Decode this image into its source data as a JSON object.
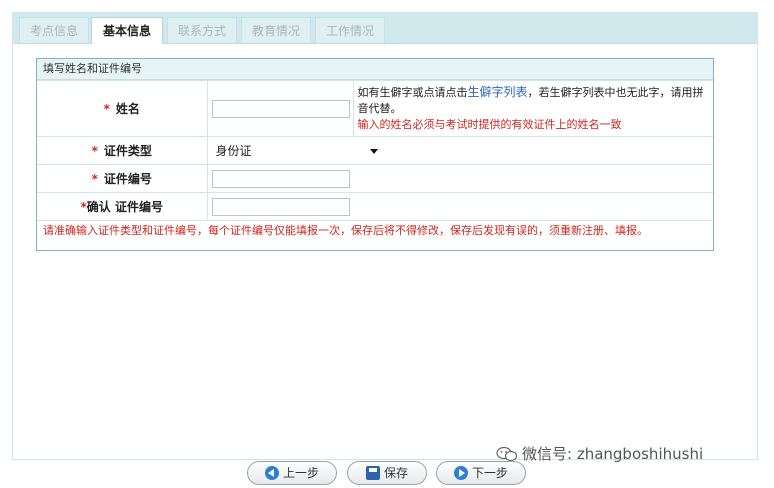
{
  "tabs": [
    {
      "label": "考点信息",
      "active": false
    },
    {
      "label": "基本信息",
      "active": true
    },
    {
      "label": "联系方式",
      "active": false
    },
    {
      "label": "教育情况",
      "active": false
    },
    {
      "label": "工作情况",
      "active": false
    }
  ],
  "section": {
    "title": "填写姓名和证件编号",
    "required_mark": "*",
    "name": {
      "label": "姓名",
      "value": "",
      "hint_before": "如有生僻字或点请点击",
      "hint_link": "生僻字列表",
      "hint_after": "，若生僻字列表中也无此字，请用拼音代替。",
      "hint_red": "输入的姓名必须与考试时提供的有效证件上的姓名一致"
    },
    "id_type": {
      "label": "证件类型",
      "value": "身份证"
    },
    "id_number": {
      "label": "证件编号",
      "value": ""
    },
    "id_confirm": {
      "label": "确认 证件编号",
      "value": ""
    },
    "note": "请准确输入证件类型和证件编号，每个证件编号仅能填报一次，保存后将不得修改，保存后发现有误的，须重新注册、填报。"
  },
  "buttons": {
    "prev": "上一步",
    "save": "保存",
    "next": "下一步"
  },
  "watermark": "微信号: zhangboshihushi"
}
